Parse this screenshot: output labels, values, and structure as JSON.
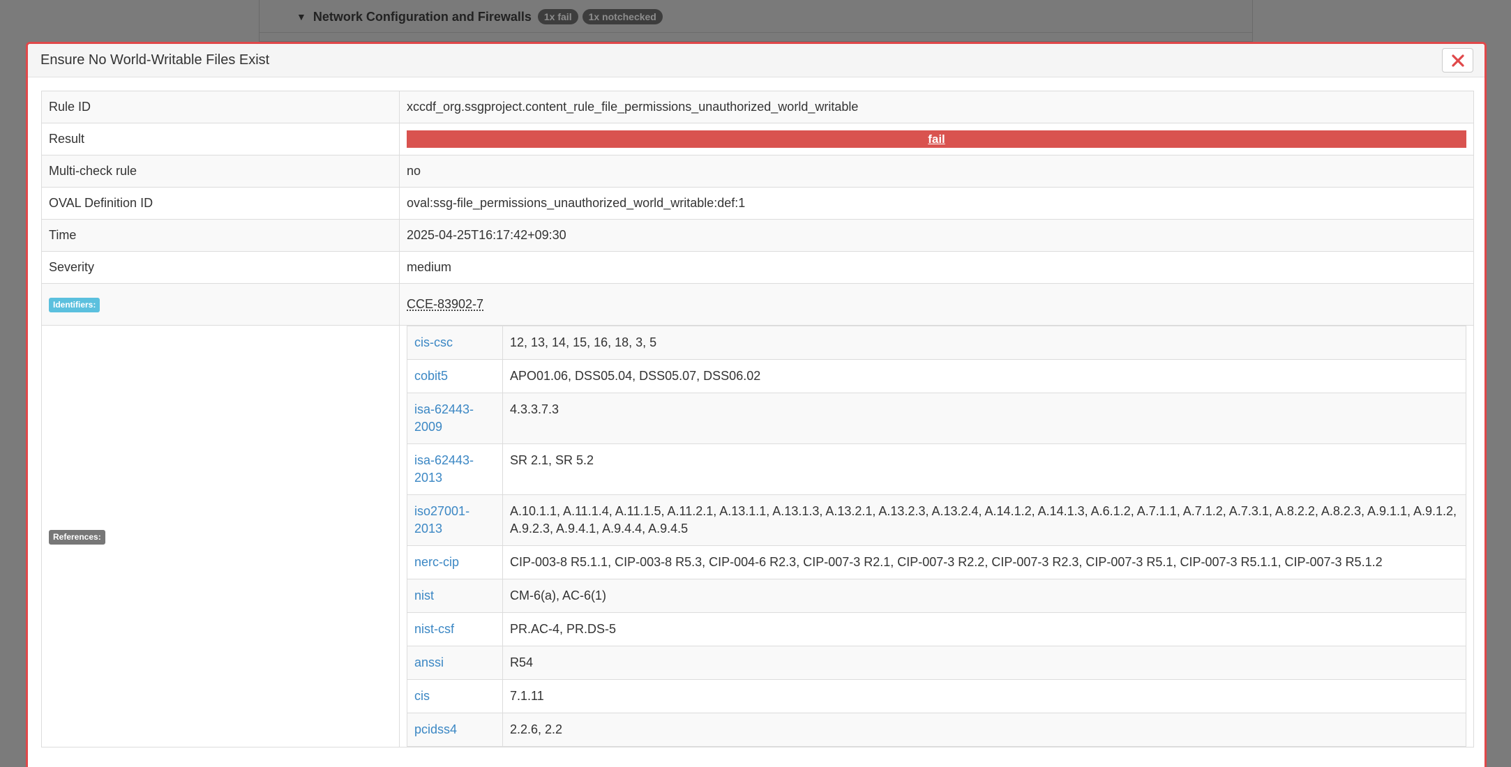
{
  "background": {
    "group_title": "Network Configuration and Firewalls",
    "badges": [
      "1x fail",
      "1x notchecked"
    ]
  },
  "modal": {
    "title": "Ensure No World-Writable Files Exist",
    "close_icon": "close-x-icon",
    "accent_color": "#e0484a"
  },
  "details": {
    "rule_id_label": "Rule ID",
    "rule_id": "xccdf_org.ssgproject.content_rule_file_permissions_unauthorized_world_writable",
    "result_label": "Result",
    "result": "fail",
    "result_color": "#d9534f",
    "multicheck_label": "Multi-check rule",
    "multicheck": "no",
    "oval_label": "OVAL Definition ID",
    "oval": "oval:ssg-file_permissions_unauthorized_world_writable:def:1",
    "time_label": "Time",
    "time": "2025-04-25T16:17:42+09:30",
    "severity_label": "Severity",
    "severity": "medium",
    "identifiers_label": "Identifiers:",
    "identifier": "CCE-83902-7",
    "references_label": "References:"
  },
  "references": [
    {
      "name": "cis-csc",
      "value": "12, 13, 14, 15, 16, 18, 3, 5"
    },
    {
      "name": "cobit5",
      "value": "APO01.06, DSS05.04, DSS05.07, DSS06.02"
    },
    {
      "name": "isa-62443-2009",
      "value": "4.3.3.7.3"
    },
    {
      "name": "isa-62443-2013",
      "value": "SR 2.1, SR 5.2"
    },
    {
      "name": "iso27001-2013",
      "value": "A.10.1.1, A.11.1.4, A.11.1.5, A.11.2.1, A.13.1.1, A.13.1.3, A.13.2.1, A.13.2.3, A.13.2.4, A.14.1.2, A.14.1.3, A.6.1.2, A.7.1.1, A.7.1.2, A.7.3.1, A.8.2.2, A.8.2.3, A.9.1.1, A.9.1.2, A.9.2.3, A.9.4.1, A.9.4.4, A.9.4.5"
    },
    {
      "name": "nerc-cip",
      "value": "CIP-003-8 R5.1.1, CIP-003-8 R5.3, CIP-004-6 R2.3, CIP-007-3 R2.1, CIP-007-3 R2.2, CIP-007-3 R2.3, CIP-007-3 R5.1, CIP-007-3 R5.1.1, CIP-007-3 R5.1.2"
    },
    {
      "name": "nist",
      "value": "CM-6(a), AC-6(1)"
    },
    {
      "name": "nist-csf",
      "value": "PR.AC-4, PR.DS-5"
    },
    {
      "name": "anssi",
      "value": "R54"
    },
    {
      "name": "cis",
      "value": "7.1.11"
    },
    {
      "name": "pcidss4",
      "value": "2.2.6, 2.2"
    }
  ]
}
